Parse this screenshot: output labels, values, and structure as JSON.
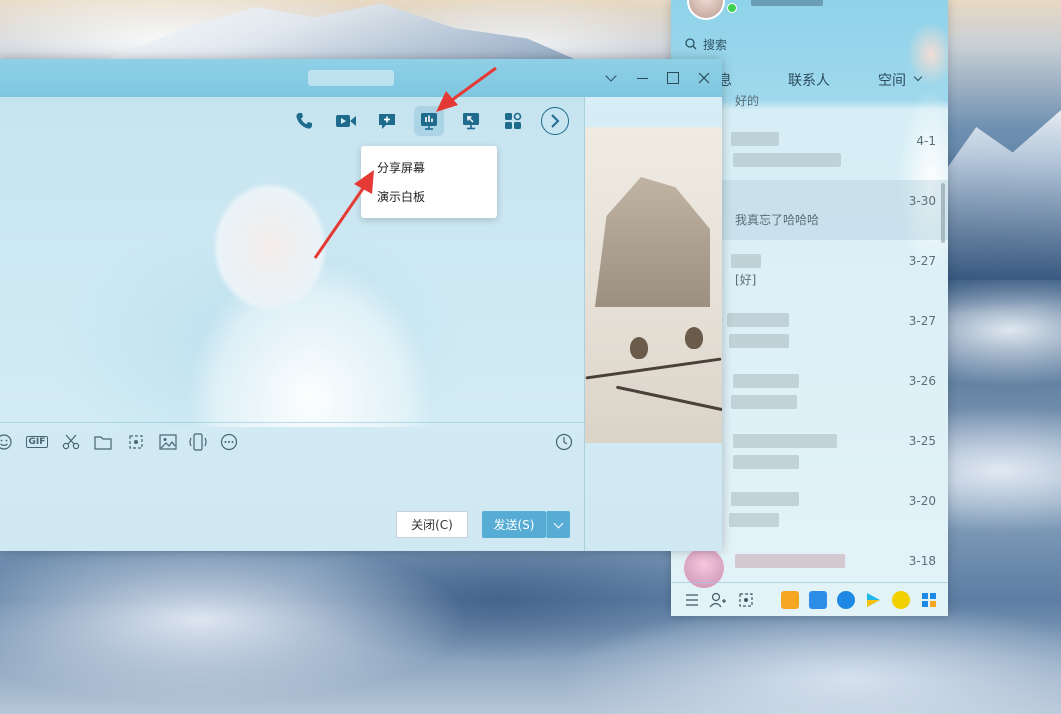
{
  "chat_window": {
    "title": "",
    "toolbar_icons": [
      "phone-icon",
      "video-icon",
      "chat-plus-icon",
      "screen-share-icon",
      "remote-desktop-icon",
      "apps-icon",
      "more-arrow-icon"
    ],
    "input_toolbar_icons": [
      "emoji-icon",
      "gif-icon",
      "scissors-icon",
      "folder-icon",
      "screenshot-icon",
      "image-icon",
      "shake-icon",
      "more-icon",
      "history-clock-icon"
    ],
    "gif_label": "GIF",
    "close_button": "关闭(C)",
    "send_button": "发送(S)"
  },
  "share_menu": {
    "items": [
      {
        "label": "分享屏幕"
      },
      {
        "label": "演示白板"
      }
    ]
  },
  "contacts_panel": {
    "search_placeholder": "搜索",
    "tabs": [
      {
        "label": "息"
      },
      {
        "label": "联系人"
      },
      {
        "label": "空间"
      }
    ],
    "top_partial_msg": "好的",
    "contacts": [
      {
        "date": "4-1",
        "message": ""
      },
      {
        "date": "3-30",
        "message": "我真忘了哈哈哈"
      },
      {
        "date": "3-27",
        "message": "[好]"
      },
      {
        "date": "3-27",
        "message": ""
      },
      {
        "date": "3-26",
        "message": ""
      },
      {
        "date": "3-25",
        "message": ""
      },
      {
        "date": "3-20",
        "message": ""
      },
      {
        "date": "3-18",
        "message": ""
      }
    ],
    "bottom_icons": [
      "menu-icon",
      "add-contact-icon",
      "screenshot-icon",
      "game-icon",
      "mail-icon",
      "cloud-icon",
      "video-play-icon",
      "music-icon",
      "apps-grid-icon"
    ]
  },
  "colors": {
    "accent": "#56acd4",
    "arrow": "#e53935",
    "online": "#3fcf4e"
  }
}
